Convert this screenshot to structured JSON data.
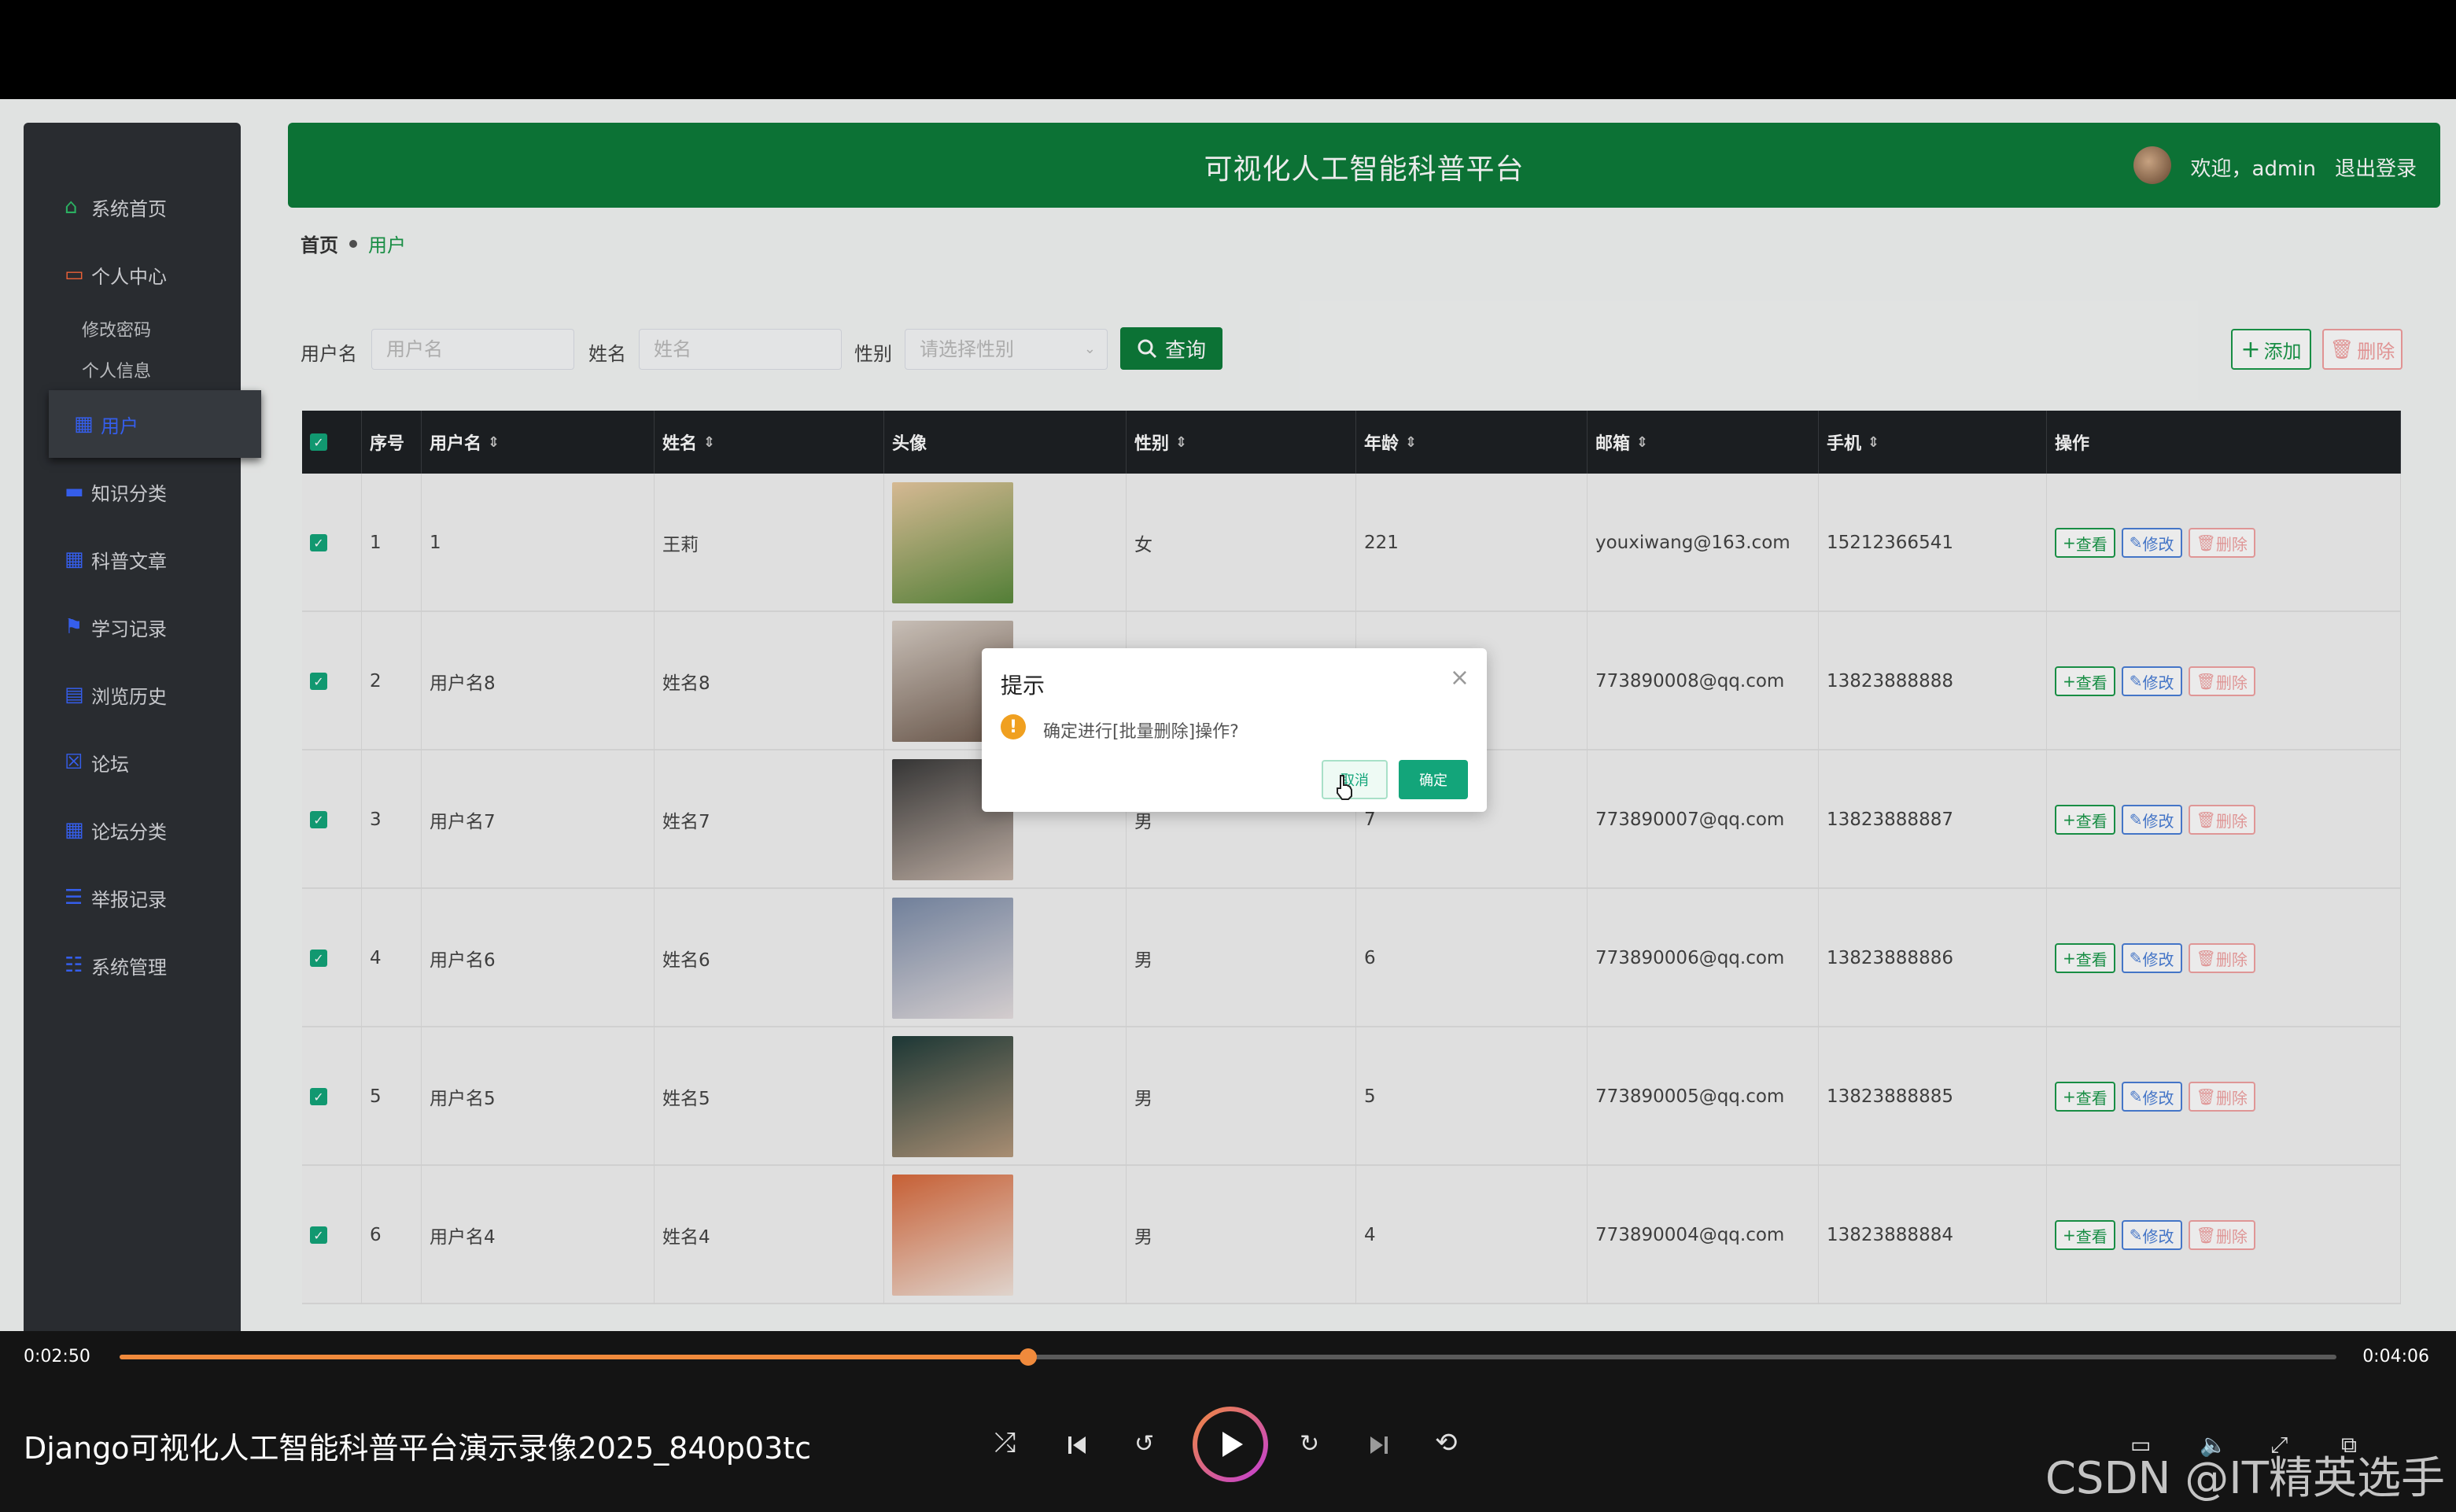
{
  "header": {
    "title": "可视化人工智能科普平台",
    "welcome": "欢迎，admin",
    "logout": "退出登录"
  },
  "sidebar": {
    "items": [
      {
        "label": "系统首页",
        "icon": "home-icon"
      },
      {
        "label": "个人中心",
        "icon": "wallet-icon"
      },
      {
        "label": "修改密码",
        "sub": true
      },
      {
        "label": "个人信息",
        "sub": true
      },
      {
        "label": "用户",
        "icon": "grid-icon",
        "active": true
      },
      {
        "label": "知识分类",
        "icon": "monitor-icon"
      },
      {
        "label": "科普文章",
        "icon": "grid-icon"
      },
      {
        "label": "学习记录",
        "icon": "flag-icon"
      },
      {
        "label": "浏览历史",
        "icon": "clipboard-icon"
      },
      {
        "label": "论坛",
        "icon": "checkbox-icon"
      },
      {
        "label": "论坛分类",
        "icon": "grid-icon"
      },
      {
        "label": "举报记录",
        "icon": "list-icon"
      },
      {
        "label": "系统管理",
        "icon": "sliders-icon"
      }
    ]
  },
  "breadcrumb": {
    "home": "首页",
    "current": "用户"
  },
  "search": {
    "username_label": "用户名",
    "username_placeholder": "用户名",
    "name_label": "姓名",
    "name_placeholder": "姓名",
    "gender_label": "性别",
    "gender_placeholder": "请选择性别",
    "query": "查询",
    "add": "添加",
    "delete": "删除"
  },
  "table": {
    "columns": [
      "序号",
      "用户名",
      "姓名",
      "头像",
      "性别",
      "年龄",
      "邮箱",
      "手机",
      "操作"
    ],
    "rows": [
      {
        "no": "1",
        "username": "1",
        "name": "王莉",
        "gender": "女",
        "age": "221",
        "email": "youxiwang@163.com",
        "phone": "15212366541",
        "photo": [
          "#e8c9a0",
          "#5a8a3c"
        ]
      },
      {
        "no": "2",
        "username": "用户名8",
        "name": "姓名8",
        "gender": "",
        "age": "",
        "email": "773890008@qq.com",
        "phone": "13823888888",
        "photo": [
          "#d9cfc6",
          "#6e5a4d"
        ]
      },
      {
        "no": "3",
        "username": "用户名7",
        "name": "姓名7",
        "gender": "男",
        "age": "7",
        "email": "773890007@qq.com",
        "phone": "13823888887",
        "photo": [
          "#3a3a3a",
          "#c9b8ad"
        ]
      },
      {
        "no": "4",
        "username": "用户名6",
        "name": "姓名6",
        "gender": "男",
        "age": "6",
        "email": "773890006@qq.com",
        "phone": "13823888886",
        "photo": [
          "#7a8ba8",
          "#e6dfe0"
        ]
      },
      {
        "no": "5",
        "username": "用户名5",
        "name": "姓名5",
        "gender": "男",
        "age": "5",
        "email": "773890005@qq.com",
        "phone": "13823888885",
        "photo": [
          "#1f3c3a",
          "#b79a7d"
        ]
      },
      {
        "no": "6",
        "username": "用户名4",
        "name": "姓名4",
        "gender": "男",
        "age": "4",
        "email": "773890004@qq.com",
        "phone": "13823888884",
        "photo": [
          "#d8683a",
          "#f2e6de"
        ]
      }
    ],
    "ops": {
      "view": "查看",
      "edit": "修改",
      "delete": "删除"
    }
  },
  "dialog": {
    "title": "提示",
    "message": "确定进行[批量删除]操作?",
    "cancel": "取消",
    "ok": "确定"
  },
  "player": {
    "current_time": "0:02:50",
    "total_time": "0:04:06",
    "progress": 0.41,
    "title": "Django可视化人工智能科普平台演示录像2025_840p03tc",
    "watermark": "CSDN @IT精英选手"
  },
  "colors": {
    "header_green": "#0e7c3a",
    "accent_teal": "#13a57a",
    "progress_orange": "#f08a3c"
  }
}
